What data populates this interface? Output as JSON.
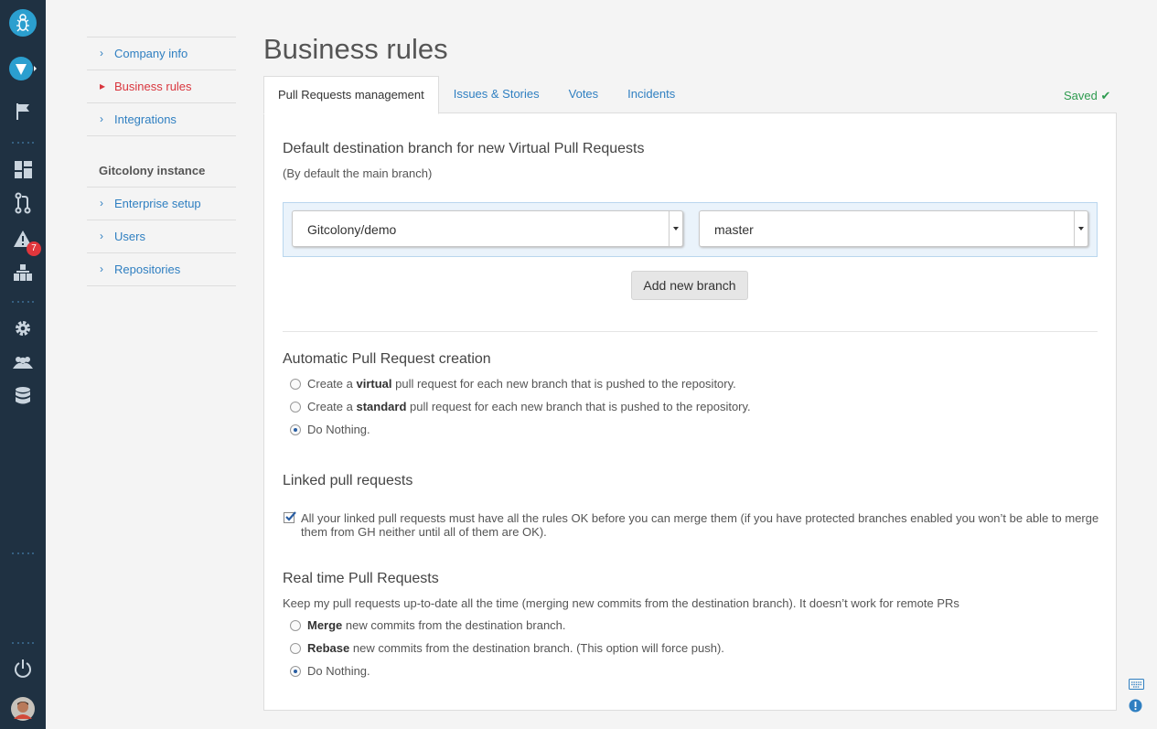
{
  "app": {
    "sidebar_badge": "7",
    "accent_color": "#2f7fc1",
    "active_color": "#d9363e",
    "rail_color": "#1f3142"
  },
  "rail_icons": [
    "gitcolony-logo-icon",
    "tour-icon",
    "flag-icon",
    "dashboard-icon",
    "pull-requests-icon",
    "alerts-icon",
    "organization-icon",
    "settings-icon",
    "users-icon",
    "database-icon",
    "power-icon",
    "avatar"
  ],
  "subnav": {
    "items": [
      {
        "label": "Company info"
      },
      {
        "label": "Business rules"
      },
      {
        "label": "Integrations"
      }
    ],
    "group_title": "Gitcolony instance",
    "group_items": [
      {
        "label": "Enterprise setup"
      },
      {
        "label": "Users"
      },
      {
        "label": "Repositories"
      }
    ]
  },
  "page": {
    "title": "Business rules",
    "saved_label": "Saved",
    "tabs": [
      {
        "label": "Pull Requests management"
      },
      {
        "label": "Issues & Stories"
      },
      {
        "label": "Votes"
      },
      {
        "label": "Incidents"
      }
    ]
  },
  "default_branch": {
    "heading": "Default destination branch for new Virtual Pull Requests",
    "note": "(By default the main branch)",
    "repo_value": "Gitcolony/demo",
    "branch_value": "master",
    "add_button": "Add new branch"
  },
  "auto_pr": {
    "heading": "Automatic Pull Request creation",
    "options": [
      {
        "pre": "Create a ",
        "bold": "virtual",
        "post": " pull request for each new branch that is pushed to the repository.",
        "checked": false
      },
      {
        "pre": "Create a ",
        "bold": "standard",
        "post": " pull request for each new branch that is pushed to the repository.",
        "checked": false
      },
      {
        "pre": "",
        "bold": "",
        "post": "Do Nothing.",
        "checked": true
      }
    ]
  },
  "linked": {
    "heading": "Linked pull requests",
    "checkbox_text": "All your linked pull requests must have all the rules OK before you can merge them (if you have protected branches enabled you won’t be able to merge them from GH neither until all of them are OK).",
    "checked": true
  },
  "realtime": {
    "heading": "Real time Pull Requests",
    "description": "Keep my pull requests up-to-date all the time (merging new commits from the destination branch). It doesn’t work for remote PRs",
    "options": [
      {
        "bold": "Merge",
        "post": " new commits from the destination branch.",
        "checked": false
      },
      {
        "bold": "Rebase",
        "post": " new commits from the destination branch. (This option will force push).",
        "checked": false
      },
      {
        "bold": "",
        "post": "Do Nothing.",
        "checked": true
      }
    ]
  }
}
